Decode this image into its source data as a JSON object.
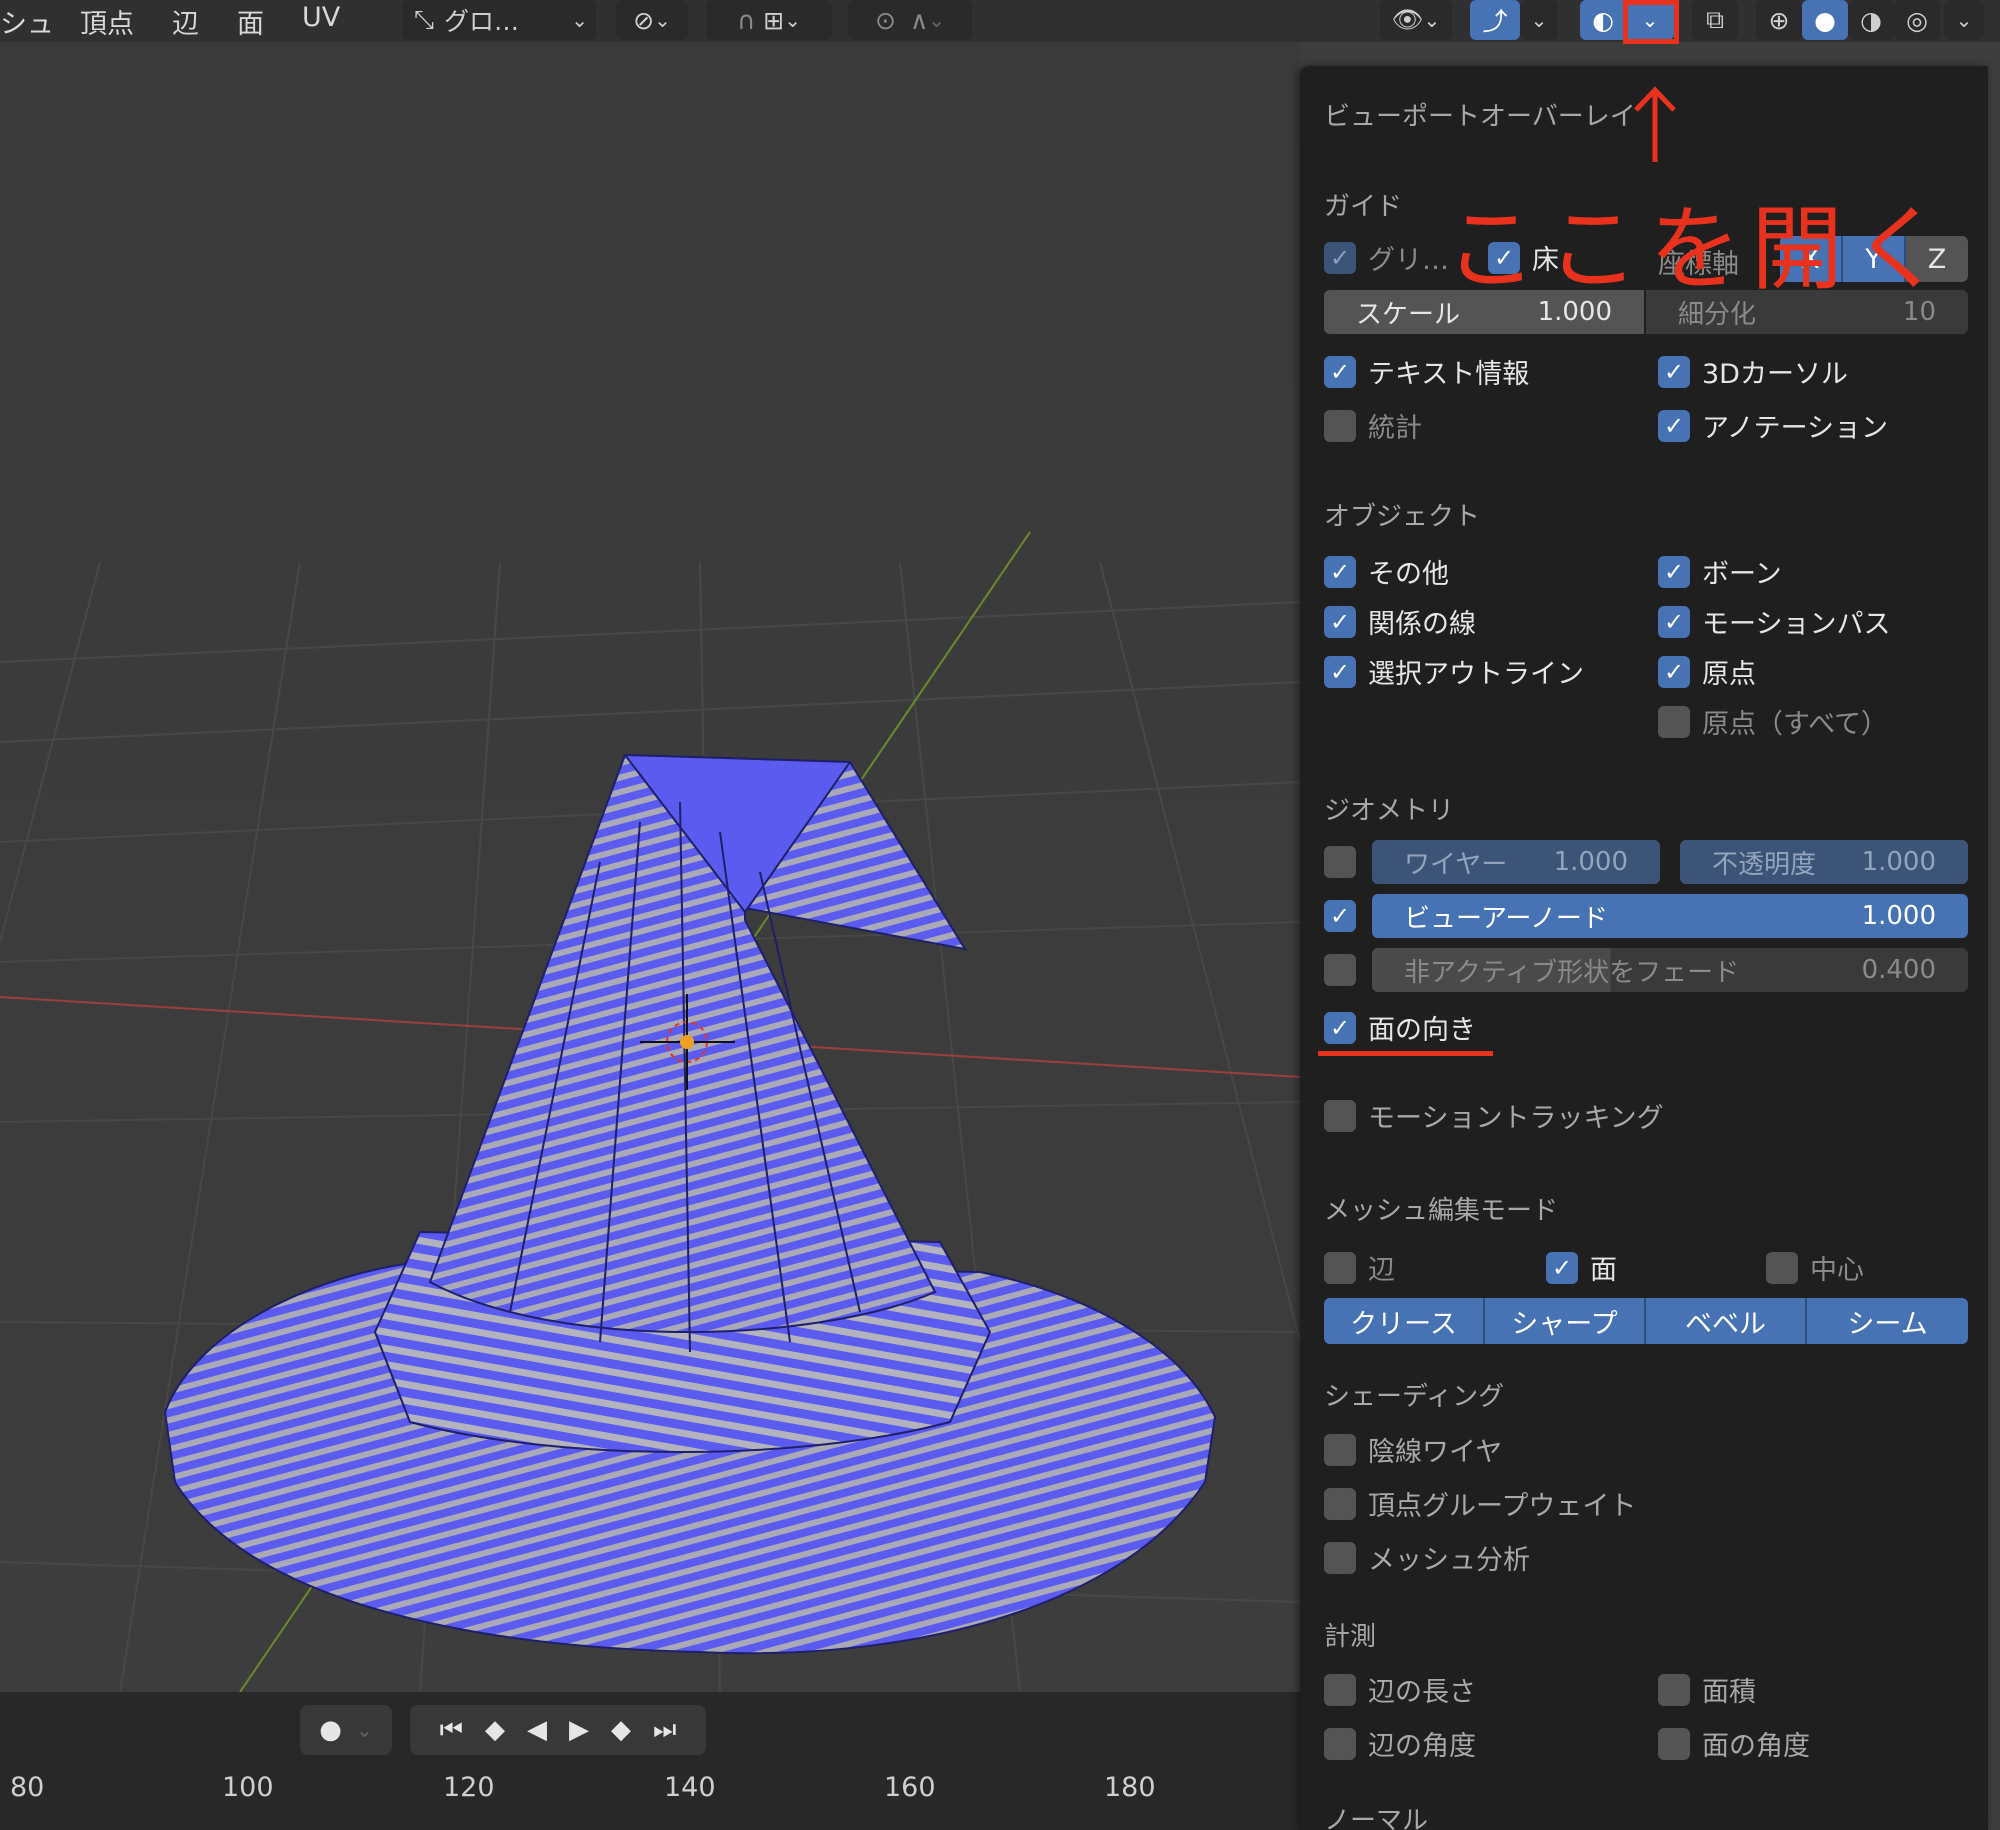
{
  "header": {
    "menu": [
      "シュ",
      "頂点",
      "辺",
      "面",
      "UV"
    ],
    "transform_orientation": "グロ…"
  },
  "timeline": {
    "frames": [
      "80",
      "100",
      "120",
      "140",
      "160",
      "180"
    ]
  },
  "overlay": {
    "title": "ビューポートオーバーレイ",
    "guides": {
      "heading": "ガイド",
      "grid": "グリ…",
      "floor": "床",
      "axes_label": "座標軸",
      "axes": [
        "X",
        "Y",
        "Z"
      ],
      "scale_label": "スケール",
      "scale_value": "1.000",
      "subdiv_label": "細分化",
      "subdiv_value": "10",
      "text_info": "テキスト情報",
      "cursor_3d": "3Dカーソル",
      "stats": "統計",
      "annotations": "アノテーション"
    },
    "objects": {
      "heading": "オブジェクト",
      "extras": "その他",
      "bones": "ボーン",
      "relationship_lines": "関係の線",
      "motion_paths": "モーションパス",
      "outline_selected": "選択アウトライン",
      "origins": "原点",
      "origins_all": "原点（すべて）"
    },
    "geometry": {
      "heading": "ジオメトリ",
      "wireframe_label": "ワイヤー",
      "wireframe_value": "1.000",
      "opacity_label": "不透明度",
      "opacity_value": "1.000",
      "viewer_node_label": "ビューアーノード",
      "viewer_node_value": "1.000",
      "fade_label": "非アクティブ形状をフェード",
      "fade_value": "0.400",
      "face_orientation": "面の向き"
    },
    "motion_tracking": "モーショントラッキング",
    "mesh_edit": {
      "heading": "メッシュ編集モード",
      "edges": "辺",
      "faces": "面",
      "center": "中心",
      "buttons": [
        "クリース",
        "シャープ",
        "ベベル",
        "シーム"
      ]
    },
    "shading": {
      "heading": "シェーディング",
      "hidden_wire": "陰線ワイヤ",
      "vertex_group_weights": "頂点グループウェイト",
      "mesh_analysis": "メッシュ分析"
    },
    "measurement": {
      "heading": "計測",
      "edge_length": "辺の長さ",
      "face_area": "面積",
      "edge_angle": "辺の角度",
      "face_angle": "面の角度"
    },
    "normals_heading": "ノーマル"
  },
  "annotation": {
    "text": "ここを開く",
    "color": "#e8321e"
  },
  "colors": {
    "accent": "#4772b3",
    "panel_bg": "#1f1f1f",
    "viewport_bg": "#3d3d3d",
    "mesh_blue": "#5b5bf0"
  }
}
